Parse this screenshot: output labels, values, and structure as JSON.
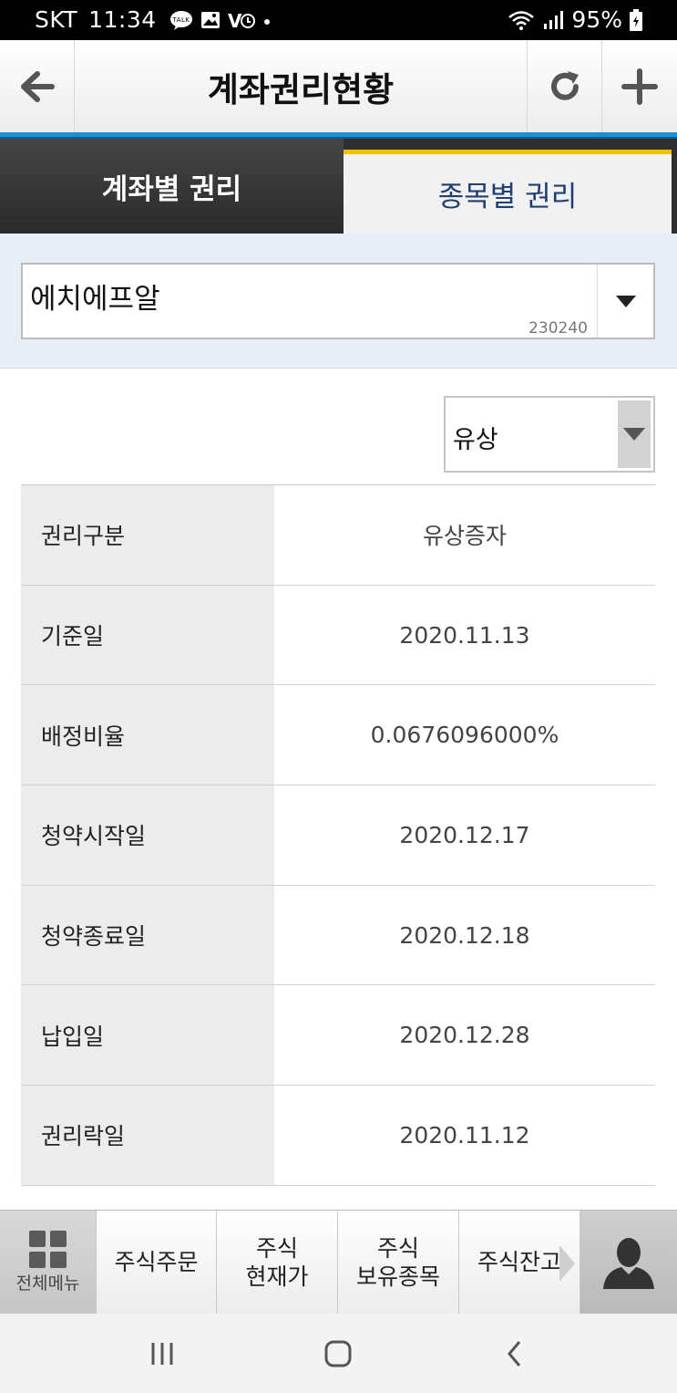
{
  "status_bar": {
    "carrier": "SKT",
    "time": "11:34",
    "battery": "95%",
    "notification_icons": [
      "talk-icon",
      "gallery-icon",
      "volte-icon",
      "dot-icon"
    ],
    "system_icons": [
      "wifi-icon",
      "signal-icon",
      "battery-icon"
    ]
  },
  "header": {
    "title": "계좌권리현황",
    "back_icon": "back-arrow-icon",
    "refresh_icon": "refresh-icon",
    "add_icon": "plus-icon"
  },
  "tabs": [
    {
      "label": "계좌별 권리",
      "active": false
    },
    {
      "label": "종목별 권리",
      "active": true
    }
  ],
  "stock_selector": {
    "name": "에치에프알",
    "code": "230240"
  },
  "rights_type": {
    "selected": "유상"
  },
  "rights_table": [
    {
      "key": "권리구분",
      "value": "유상증자"
    },
    {
      "key": "기준일",
      "value": "2020.11.13"
    },
    {
      "key": "배정비율",
      "value": "0.0676096000%"
    },
    {
      "key": "청약시작일",
      "value": "2020.12.17"
    },
    {
      "key": "청약종료일",
      "value": "2020.12.18"
    },
    {
      "key": "납입일",
      "value": "2020.12.28"
    },
    {
      "key": "권리락일",
      "value": "2020.11.12"
    }
  ],
  "bottom_nav": {
    "menu_label": "전체메뉴",
    "order": "주식주문",
    "price_line1": "주식",
    "price_line2": "현재가",
    "hold_line1": "주식",
    "hold_line2": "보유종목",
    "balance": "주식잔고"
  },
  "colors": {
    "accent_blue": "#1f8fd2",
    "tab_active_border": "#f2c200",
    "tab_active_text": "#1f3e73",
    "tab_inactive_bg": "#2f2f2f"
  }
}
